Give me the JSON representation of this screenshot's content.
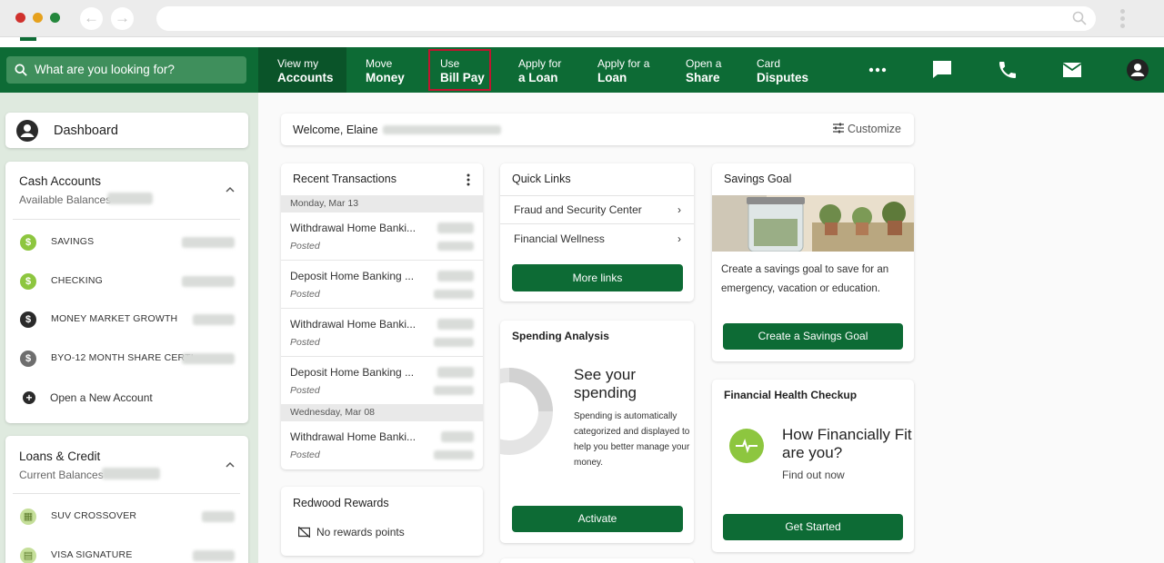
{
  "colors": {
    "brand_green": "#0d6b35",
    "nav_active": "#0a5429",
    "highlight": "#c0152f",
    "accent_lime": "#8dc63f"
  },
  "search": {
    "placeholder": "What are you looking for?"
  },
  "nav": [
    {
      "line1": "View my",
      "line2": "Accounts"
    },
    {
      "line1": "Move",
      "line2": "Money"
    },
    {
      "line1": "Use",
      "line2": "Bill Pay"
    },
    {
      "line1": "Apply for",
      "line2": "a Loan"
    },
    {
      "line1": "Apply for a",
      "line2": "Loan"
    },
    {
      "line1": "Open a",
      "line2": "Share"
    },
    {
      "line1": "Card",
      "line2": "Disputes"
    }
  ],
  "nav_icons": [
    "more-icon",
    "chat-icon",
    "phone-icon",
    "mail-icon",
    "profile-icon"
  ],
  "sidebar": {
    "dashboard_label": "Dashboard",
    "cash": {
      "title": "Cash Accounts",
      "subtitle": "Available Balances",
      "accounts": [
        "SAVINGS",
        "CHECKING",
        "MONEY MARKET GROWTH",
        "BYO-12 MONTH SHARE CERTI..."
      ],
      "open_account": "Open a New Account"
    },
    "loans": {
      "title": "Loans & Credit",
      "subtitle": "Current Balances",
      "accounts": [
        "SUV CROSSOVER",
        "VISA SIGNATURE"
      ]
    }
  },
  "welcome": {
    "text": "Welcome, Elaine",
    "customize": "Customize"
  },
  "transactions": {
    "title": "Recent Transactions",
    "dates": [
      "Monday, Mar 13",
      "Wednesday, Mar 08"
    ],
    "rows": [
      {
        "name": "Withdrawal Home Banki...",
        "status": "Posted"
      },
      {
        "name": "Deposit Home Banking ...",
        "status": "Posted"
      },
      {
        "name": "Withdrawal Home Banki...",
        "status": "Posted"
      },
      {
        "name": "Deposit Home Banking ...",
        "status": "Posted"
      },
      {
        "name": "Withdrawal Home Banki...",
        "status": "Posted"
      }
    ]
  },
  "rewards": {
    "title": "Redwood Rewards",
    "text": "No rewards points"
  },
  "quick_links": {
    "title": "Quick Links",
    "items": [
      "Fraud and Security Center",
      "Financial Wellness"
    ],
    "button": "More links"
  },
  "spending": {
    "title": "Spending Analysis",
    "heading_l1": "See your",
    "heading_l2": "spending",
    "body_l1": "Spending is automatically",
    "body_l2": "categorized and displayed to",
    "body_l3": "help you better manage your",
    "body_l4": "money.",
    "button": "Activate"
  },
  "savings_goal": {
    "title": "Savings Goal",
    "body_l1": "Create a savings goal to save for an",
    "body_l2": "emergency, vacation or education.",
    "button": "Create a Savings Goal"
  },
  "health": {
    "title": "Financial Health Checkup",
    "heading_l1": "How Financially Fit",
    "heading_l2": "are you?",
    "sub": "Find out now",
    "button": "Get Started"
  }
}
